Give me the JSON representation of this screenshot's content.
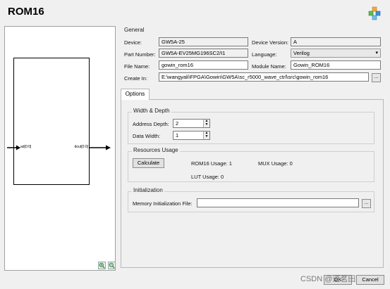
{
  "window": {
    "title": "ROM16",
    "logo_icon": "gowin-cubes-icon"
  },
  "preview": {
    "input_pin": "ad[0:0]",
    "output_pin": "dout[0:0]",
    "zoom_in_icon": "zoom-in-icon",
    "zoom_out_icon": "zoom-out-icon"
  },
  "general": {
    "title": "General",
    "device_label": "Device:",
    "device_value": "GW5A-25",
    "device_version_label": "Device Version:",
    "device_version_value": "A",
    "part_number_label": "Part Number:",
    "part_number_value": "GW5A-EV25MG196SC2/I1",
    "language_label": "Language:",
    "language_value": "Verilog",
    "file_name_label": "File Name:",
    "file_name_value": "gowin_rom16",
    "module_name_label": "Module Name:",
    "module_name_value": "Gowin_ROM16",
    "create_in_label": "Create In:",
    "create_in_value": "E:\\wangyali\\FPGA\\Gowin\\GW5A\\sc_r5000_wave_ctrl\\src\\gowin_rom16",
    "browse_label": "..."
  },
  "tabs": {
    "options_label": "Options"
  },
  "options": {
    "width_depth_title": "Width & Depth",
    "address_depth_label": "Address Depth:",
    "address_depth_value": "2",
    "data_width_label": "Data Width:",
    "data_width_value": "1",
    "resources_title": "Resources Usage",
    "calculate_label": "Calculate",
    "rom16_usage": "ROM16 Usage: 1",
    "mux_usage": "MUX Usage: 0",
    "lut_usage": "LUT Usage: 0",
    "initialization_title": "Initialization",
    "memory_init_label": "Memory Initialization File:",
    "memory_init_value": "",
    "browse_label": "..."
  },
  "footer": {
    "ok_label": "OK",
    "cancel_label": "Cancel",
    "watermark": "CSDN @道茗田"
  },
  "colors": {
    "background": "#f0f0f0",
    "field_border": "#7a7a7a"
  }
}
